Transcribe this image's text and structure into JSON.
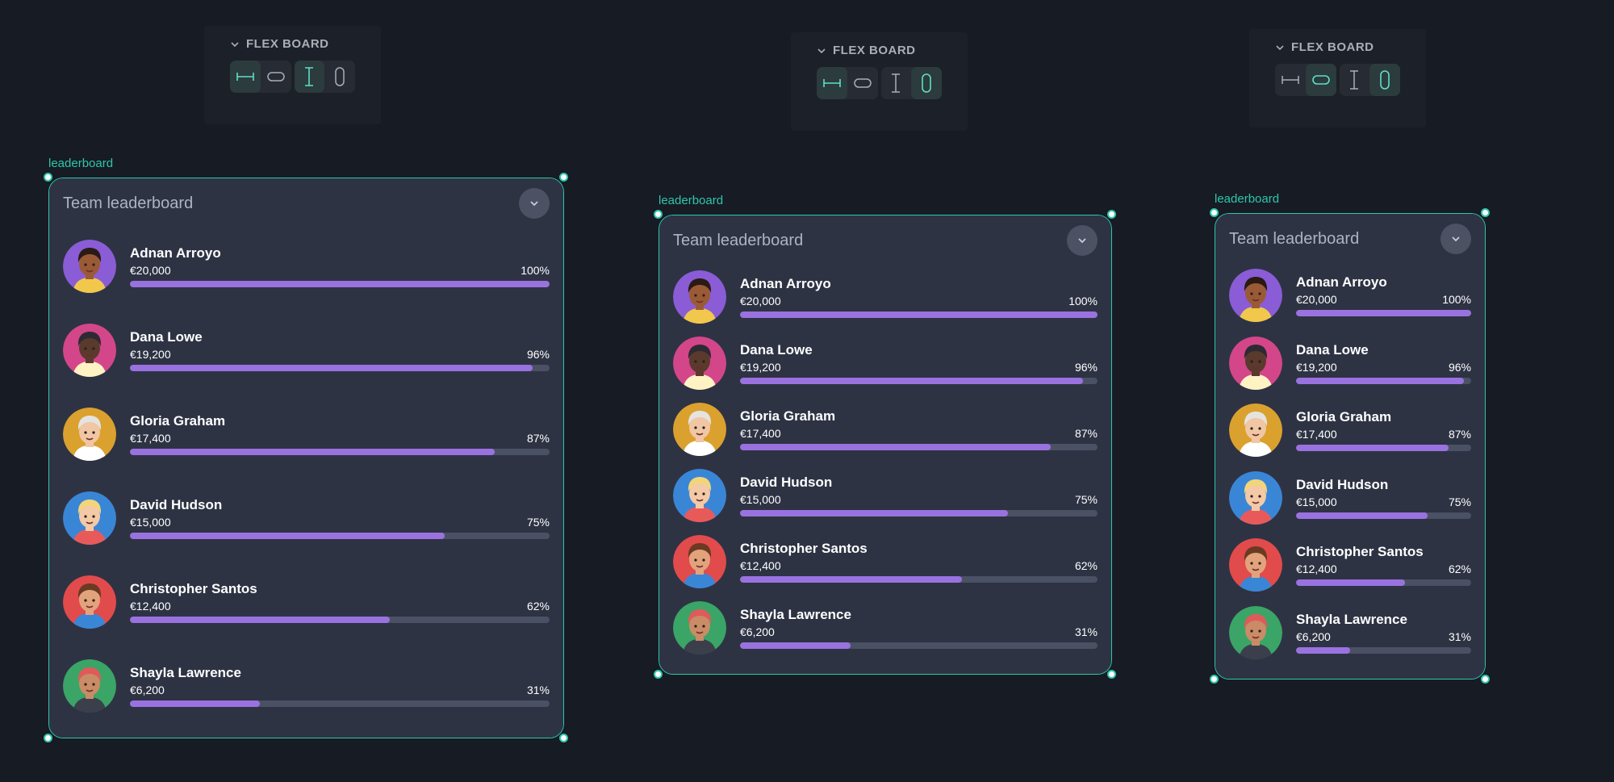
{
  "colors": {
    "accent": "#2ec6ad",
    "bar_fill": "#9a72e0",
    "bar_track": "#4a5164",
    "card_bg": "#2e3344",
    "page_bg": "#171b23"
  },
  "flex_boards": [
    {
      "title": "FLEX BOARD",
      "active_tools": [
        "horizontal-fixed",
        "vertical-fixed"
      ]
    },
    {
      "title": "FLEX BOARD",
      "active_tools": [
        "horizontal-fixed",
        "vertical-hug"
      ]
    },
    {
      "title": "FLEX BOARD",
      "active_tools": [
        "horizontal-hug",
        "vertical-hug"
      ]
    }
  ],
  "frames": [
    {
      "label": "leaderboard",
      "title": "Team leaderboard"
    },
    {
      "label": "leaderboard",
      "title": "Team leaderboard"
    },
    {
      "label": "leaderboard",
      "title": "Team leaderboard"
    }
  ],
  "players": [
    {
      "name": "Adnan Arroyo",
      "amount": "€20,000",
      "percent_label": "100%",
      "progress": 1.0,
      "avatar_bg": "#8a5cd6",
      "skin": "#9a5a36",
      "hair": "#2a1a14",
      "shirt": "#f1c84b"
    },
    {
      "name": "Dana Lowe",
      "amount": "€19,200",
      "percent_label": "96%",
      "progress": 0.96,
      "avatar_bg": "#d3468a",
      "skin": "#5a3a2c",
      "hair": "#2e2a33",
      "shirt": "#fff3c4"
    },
    {
      "name": "Gloria Graham",
      "amount": "€17,400",
      "percent_label": "87%",
      "progress": 0.87,
      "avatar_bg": "#dba12e",
      "skin": "#f1c6a4",
      "hair": "#e5e3e0",
      "shirt": "#ffffff"
    },
    {
      "name": "David Hudson",
      "amount": "€15,000",
      "percent_label": "75%",
      "progress": 0.75,
      "avatar_bg": "#3a86d6",
      "skin": "#f3c9a6",
      "hair": "#f2d57a",
      "shirt": "#e85a5a"
    },
    {
      "name": "Christopher Santos",
      "amount": "€12,400",
      "percent_label": "62%",
      "progress": 0.62,
      "avatar_bg": "#e24b4b",
      "skin": "#e2a37c",
      "hair": "#6b3a22",
      "shirt": "#3a86d6"
    },
    {
      "name": "Shayla Lawrence",
      "amount": "€6,200",
      "percent_label": "31%",
      "progress": 0.31,
      "avatar_bg": "#3aa566",
      "skin": "#c98c66",
      "hair": "#e05a5a",
      "shirt": "#3b3f4c"
    }
  ]
}
